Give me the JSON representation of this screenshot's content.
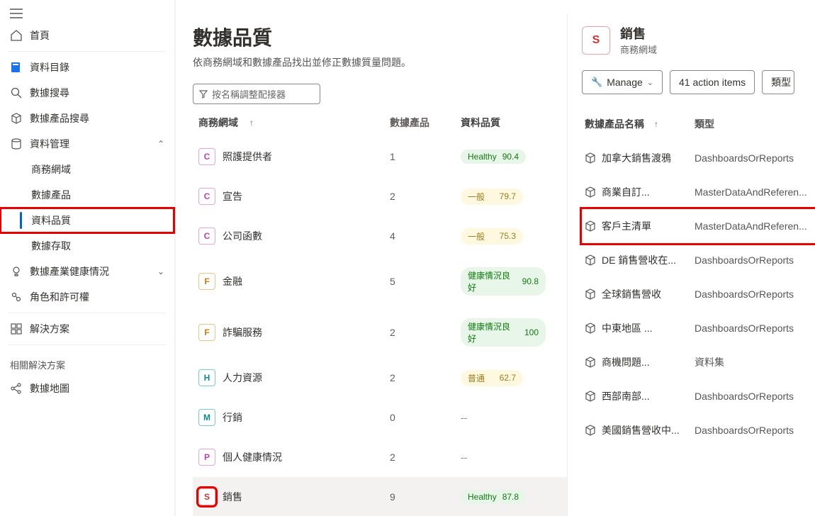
{
  "sidebar": {
    "home": "首頁",
    "catalog": "資料目錄",
    "search_data": "數據搜尋",
    "search_products": "數據產品搜尋",
    "data_mgmt": "資料管理",
    "business_domain": "商務網域",
    "data_products": "數據產品",
    "data_quality": "資料品質",
    "data_access": "數據存取",
    "health": "數據產業健康情況",
    "roles": "角色和許可權",
    "solutions": "解決方案",
    "related_label": "相關解決方案",
    "data_map": "數據地圖"
  },
  "page": {
    "title": "數據品質",
    "subtitle": "依商務網域和數據產品找出並修正數據質量問題。",
    "filter_placeholder": "按名稱調整配接器"
  },
  "table": {
    "col_domain": "商務網域",
    "col_count": "數據產品",
    "col_quality": "資料品質",
    "rows": [
      {
        "letter": "C",
        "clr": "pink",
        "name": "照護提供者",
        "count": "1",
        "pill": "green",
        "status": "Healthy",
        "score": "90.4"
      },
      {
        "letter": "C",
        "clr": "pink",
        "name": "宣告",
        "count": "2",
        "pill": "yellow",
        "status": "一般",
        "score": "79.7"
      },
      {
        "letter": "C",
        "clr": "pink",
        "name": "公司函數",
        "count": "4",
        "pill": "yellow",
        "status": "一般",
        "score": "75.3"
      },
      {
        "letter": "F",
        "clr": "orange",
        "name": "金融",
        "count": "5",
        "pill": "green",
        "status": "健康情況良好",
        "score": "90.8"
      },
      {
        "letter": "F",
        "clr": "orange",
        "name": "詐騙服務",
        "count": "2",
        "pill": "green",
        "status": "健康情況良好",
        "score": "100"
      },
      {
        "letter": "H",
        "clr": "teal",
        "name": "人力資源",
        "count": "2",
        "pill": "yellow",
        "status": "普通",
        "score": "62.7"
      },
      {
        "letter": "M",
        "clr": "teal",
        "name": "行銷",
        "count": "0",
        "pill": "none",
        "status": "--",
        "score": ""
      },
      {
        "letter": "P",
        "clr": "pink",
        "name": "個人健康情況",
        "count": "2",
        "pill": "none",
        "status": "--",
        "score": ""
      },
      {
        "letter": "S",
        "clr": "red",
        "name": "銷售",
        "count": "9",
        "pill": "green",
        "status": "Healthy",
        "score": "87.8"
      }
    ]
  },
  "detail": {
    "title": "銷售",
    "subtitle": "商務網域",
    "manage": "Manage",
    "action_items": "41 action items",
    "type_btn": "類型",
    "col_name": "數據產品名稱",
    "col_type": "類型",
    "rows": [
      {
        "name": "加拿大銷售渡鴉",
        "type": "DashboardsOrReports"
      },
      {
        "name": "商業自訂...",
        "type": "MasterDataAndReferen..."
      },
      {
        "name": "客戶主清單",
        "type": "MasterDataAndReferen..."
      },
      {
        "name": "DE 銷售營收在...",
        "type": "DashboardsOrReports"
      },
      {
        "name": "全球銷售營收",
        "type": "DashboardsOrReports"
      },
      {
        "name": "中東地區 ...",
        "type": "DashboardsOrReports"
      },
      {
        "name": "商機問題...",
        "type": "資料集"
      },
      {
        "name": "西部南部...",
        "type": "DashboardsOrReports"
      },
      {
        "name": "美國銷售營收中...",
        "type": "DashboardsOrReports"
      }
    ]
  }
}
